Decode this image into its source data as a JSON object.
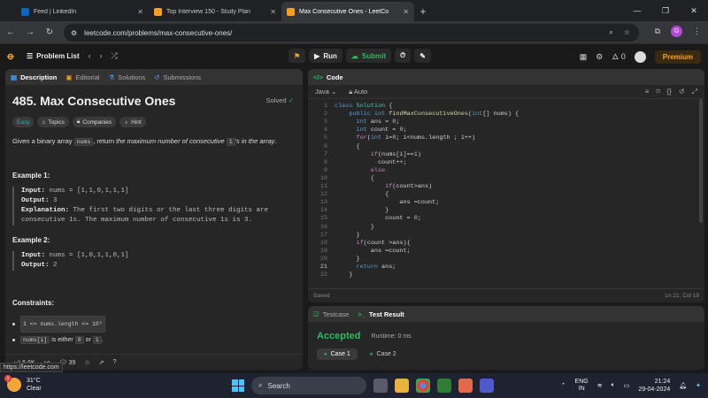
{
  "browser": {
    "tabs": [
      {
        "title": "Feed | LinkedIn",
        "color": "#0a66c2",
        "icon": "linkedin-icon"
      },
      {
        "title": "Top Interview 150 - Study Plan",
        "color": "#f89f1b",
        "icon": "leetcode-icon"
      },
      {
        "title": "Max Consecutive Ones - LeetCo",
        "color": "#f89f1b",
        "icon": "leetcode-icon"
      }
    ],
    "url": "leetcode.com/problems/max-consecutive-ones/",
    "profile_initial": "G"
  },
  "topnav": {
    "problem_list": "Problem List",
    "run": "Run",
    "submit": "Submit",
    "streak": "0",
    "premium": "Premium"
  },
  "description": {
    "tabs": [
      "Description",
      "Editorial",
      "Solutions",
      "Submissions"
    ],
    "title": "485. Max Consecutive Ones",
    "solved": "Solved",
    "tags": [
      "Easy",
      "Topics",
      "Companies",
      "Hint"
    ],
    "stmt_pre": "Given a binary array ",
    "stmt_code1": "nums",
    "stmt_mid": ", return ",
    "stmt_em": "the maximum number of consecutive ",
    "stmt_code2": "1",
    "stmt_em2": "'s in the array",
    "stmt_end": ".",
    "ex1_title": "Example 1:",
    "ex1_input_label": "Input:",
    "ex1_input": " nums = [1,1,0,1,1,1]",
    "ex1_output_label": "Output:",
    "ex1_output": " 3",
    "ex1_expl_label": "Explanation:",
    "ex1_expl1": " The first two digits or the last three digits are",
    "ex1_expl2": "consecutive 1s. The maximum number of consecutive 1s is 3.",
    "ex2_title": "Example 2:",
    "ex2_input_label": "Input:",
    "ex2_input": " nums = [1,0,1,1,0,1]",
    "ex2_output_label": "Output:",
    "ex2_output": " 2",
    "constraints_title": "Constraints:",
    "constraint1": "1 <= nums.length <= 10⁵",
    "constraint2_code": "nums[i]",
    "constraint2_mid": " is either ",
    "constraint2_a": "0",
    "constraint2_or": " or ",
    "constraint2_b": "1",
    "constraint2_end": ".",
    "likes": "5.6K",
    "comments": "39"
  },
  "status_url": "https://leetcode.com",
  "editor": {
    "tab": "Code",
    "language": "Java",
    "mode": "Auto",
    "saved": "Saved",
    "position": "Ln 21, Col 19",
    "lines": [
      "class Solution {",
      "    public int findMaxConsecutiveOnes(int[] nums) {",
      "      int ans = 0;",
      "      int count = 0;",
      "      for(int i=0; i<nums.length ; i++)",
      "      {",
      "          if(nums[i]==1)",
      "            count++;",
      "          else",
      "          {",
      "              if(count>ans)",
      "              {",
      "                  ans =count;",
      "              }",
      "              count = 0;",
      "          }",
      "      }",
      "      if(count >ans){",
      "          ans =count;",
      "      }",
      "      return ans;",
      "    }"
    ],
    "line_numbers": [
      "1",
      "2",
      "3",
      "4",
      "5",
      "6",
      "7",
      "8",
      "9",
      "10",
      "11",
      "12",
      "13",
      "14",
      "15",
      "16",
      "17",
      "18",
      "19",
      "20",
      "21",
      "22"
    ]
  },
  "result": {
    "tabs": [
      "Testcase",
      "Test Result"
    ],
    "status": "Accepted",
    "runtime": "Runtime: 0 ms",
    "cases": [
      "Case 1",
      "Case 2"
    ]
  },
  "taskbar": {
    "temp": "31°C",
    "condition": "Clear",
    "badge": "1",
    "search": "Search",
    "lang1": "ENG",
    "lang2": "IN",
    "time": "21:24",
    "date": "29-04-2024"
  }
}
